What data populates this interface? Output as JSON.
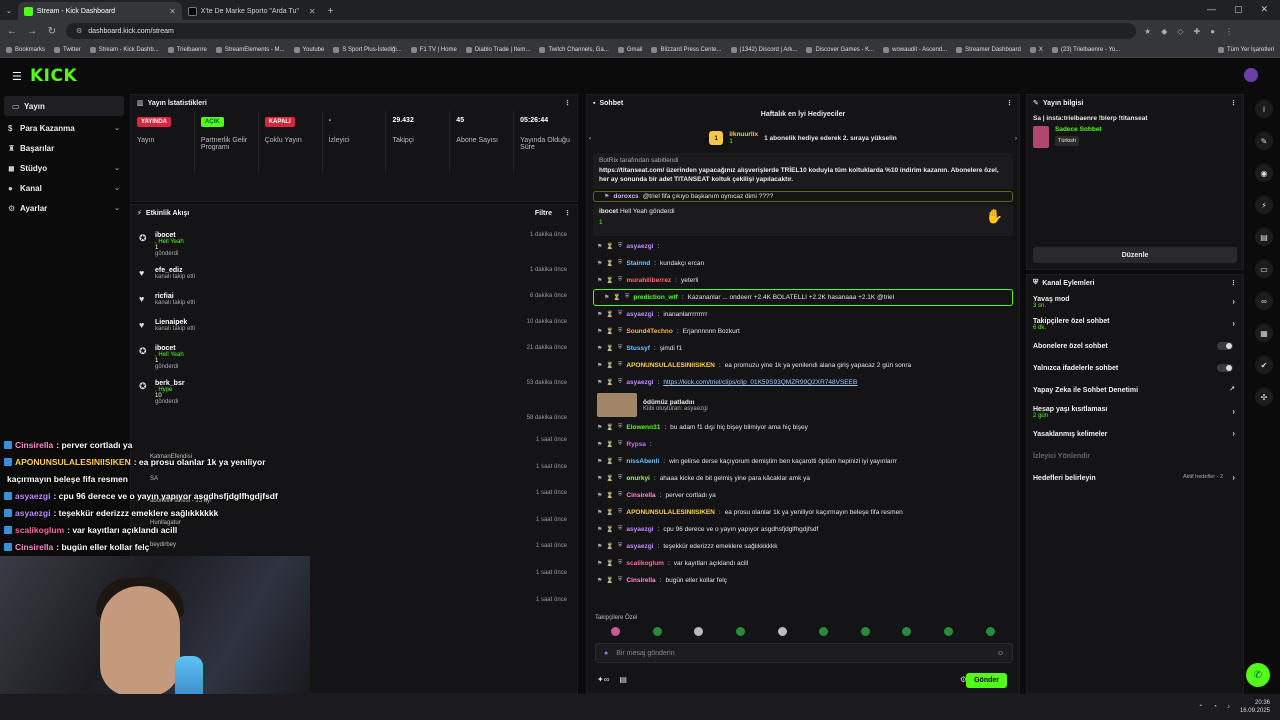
{
  "browser": {
    "tabs": [
      {
        "title": "Stream - Kick Dashboard",
        "active": true
      },
      {
        "title": "X'te De Marke Sporto \"Arda Tu\"",
        "active": false
      }
    ],
    "url": "dashboard.kick.com/stream",
    "bookmarks": [
      "Bookmarks",
      "Twitter",
      "Stream - Kick Dashb...",
      "Trielbaenre",
      "StreamElements - M...",
      "Youtube",
      "S Sport Plus-İstediği...",
      "F1 TV | Home",
      "Diablo Trade | Item...",
      "Twitch Channels, Ga...",
      "Gmail",
      "Blizzard Press Cente...",
      "(1342) Discord | Ark...",
      "Discover Games - K...",
      "wowaudit - Ascend...",
      "Streamer Dashboard",
      "X",
      "(23) Trielbaenre - Yo...",
      "Tüm Yer İşaretleri"
    ]
  },
  "logo": "KICK",
  "sidebar": {
    "items": [
      {
        "label": "Yayın",
        "icon": "video-icon",
        "active": true
      },
      {
        "label": "Para Kazanma",
        "icon": "dollar-icon",
        "active": false
      },
      {
        "label": "Başarılar",
        "icon": "trophy-icon",
        "active": false
      },
      {
        "label": "Stüdyo",
        "icon": "studio-icon",
        "active": false
      },
      {
        "label": "Kanal",
        "icon": "user-icon",
        "active": false
      },
      {
        "label": "Ayarlar",
        "icon": "gear-icon",
        "active": false
      }
    ]
  },
  "stats": {
    "title": "Yayın İstatistikleri",
    "items": [
      {
        "badge": "YAYINDA",
        "label": "Yayın",
        "color": "red"
      },
      {
        "badge": "AÇIK",
        "label": "Partnerlik Gelir Programı",
        "color": "green"
      },
      {
        "badge": "KAPALI",
        "label": "Çoklu Yayın",
        "color": "red"
      },
      {
        "value": "-",
        "label": "İzleyici"
      },
      {
        "value": "29.432",
        "label": "Takipçi"
      },
      {
        "value": "45",
        "label": "Abone Sayısı"
      },
      {
        "value": "05:26:44",
        "label": "Yayında Olduğu Süre"
      }
    ]
  },
  "activity": {
    "title": "Etkinlik Akışı",
    "filter": "Filtre",
    "items": [
      {
        "name": "ibocet",
        "sub": ", Hell Yeah",
        "count": "1",
        "action": "gönderdi",
        "time": "1 dakika önce",
        "icon": "gift-icon"
      },
      {
        "name": "efe_ediz",
        "action": "kanalı takip etti",
        "time": "1 dakika önce",
        "icon": "heart-icon"
      },
      {
        "name": "ricfiai",
        "action": "kanalı takip etti",
        "time": "6 dakika önce",
        "icon": "heart-icon"
      },
      {
        "name": "Lienaipek",
        "action": "kanalı takip etti",
        "time": "10 dakika önce",
        "icon": "heart-icon"
      },
      {
        "name": "ibocet",
        "sub": ", Hell Yeah",
        "count": "1",
        "action": "gönderdi",
        "time": "21 dakika önce",
        "icon": "gift-icon"
      },
      {
        "name": "berk_bsr",
        "sub": ", Hype",
        "count": "10",
        "action": "gönderdi",
        "time": "53 dakika önce",
        "icon": "gift-icon"
      }
    ],
    "extra_times": [
      "58 dakika önce",
      "1 saat önce",
      "1 saat önce",
      "1 saat önce",
      "1 saat önce",
      "1 saat önce",
      "1 saat önce",
      "1 saat önce"
    ]
  },
  "chat": {
    "title": "Sohbet",
    "weekly_title": "Haftalık en İyi Hediyeciler",
    "top_gifter": "ilknuurlix",
    "top_gifter_count": "1",
    "top_gifter_note": "1 abonelik hediye ederek 2. sıraya yükselin",
    "pinned_by": "BotRix tarafından sabitlendi",
    "pinned_text": "https://titanseat.com/ üzerinden yapacağınız alışverişlerde TRİEL10 koduyla tüm koltuklarda %10 indirim kazanın. Abonelere özel, her ay sonunda bir adet TITANSEAT koltuk çekilişi yapılacaktır.",
    "gift_user": "ibocet",
    "gift_text": "Hell Yeah gönderdi",
    "gift_count": "1",
    "messages": [
      {
        "user": "doroxcs",
        "text": "@triel fifa çıkıyo başkanım oynıcaz dimi ????",
        "color": "#d6b7ff"
      },
      {
        "user": "asyaezgi",
        "text": "",
        "color": "#c08cff"
      },
      {
        "user": "Stainnd",
        "text": "kundakçı ercan",
        "color": "#6fc3ff"
      },
      {
        "user": "murahiliberrez",
        "text": "yeterli",
        "color": "#ff6b6b"
      },
      {
        "user": "prediction_wtf",
        "text": "Kazananlar ... ondeerr +2.4K BOLATELLI +2.2K hasanaaa +2.1K @triel",
        "color": "#53fc18",
        "highlight": true
      },
      {
        "user": "asyaezgi",
        "text": "inananlarrrrrrrrr",
        "color": "#c08cff"
      },
      {
        "user": "Sound4Techno",
        "text": "Erjannnnnn Bozkurt",
        "color": "#ffb347"
      },
      {
        "user": "Stussyf",
        "text": "şimdi f1",
        "color": "#6fc3ff"
      },
      {
        "user": "APONUNSULALESINIISIKEN",
        "text": "ea promuzu yine 1k ya yenilendi alana giriş yapacaz 2 gün sonra",
        "color": "#ffd24d"
      },
      {
        "user": "asyaezgi",
        "text": "https://kick.com/triel/clips/clip_01K59S93QMZR99Q2XR748VSEEB",
        "color": "#c08cff"
      },
      {
        "user": "Elowenn31",
        "text": "bu adam f1 dışı hiç bişey bilmiyor ama hiç bişey",
        "color": "#53fc18"
      },
      {
        "user": "Rypsa",
        "text": "",
        "color": "#d06bff"
      },
      {
        "user": "nissAbenli",
        "text": "win gelirse derse kaçıyorum demiştim ben kaçarotti öptüm hepinizi iyi yayınlarrr",
        "color": "#6fc3ff"
      },
      {
        "user": "onurkyi",
        "text": "ahaaa kicke de bit gelmiş yine para kâcaklar amk ya",
        "color": "#b0e57c"
      },
      {
        "user": "Cinsirella",
        "text": "perver cortladı ya",
        "color": "#ff8fd0"
      },
      {
        "user": "APONUNSULALESINIISIKEN",
        "text": "ea prosu olanlar 1k ya yeniliyor kaçırmayın beleşe fifa resmen",
        "color": "#ffd24d"
      },
      {
        "user": "asyaezgi",
        "text": "cpu 96 derece ve o yayın yapıyor asgdhsfjdglfhgdjfsdf",
        "color": "#c08cff"
      },
      {
        "user": "asyaezgi",
        "text": "teşekkür ederizzz emeklere sağlıkkkkkk",
        "color": "#c08cff"
      },
      {
        "user": "scalikoglum",
        "text": "var kayıtları açıklandı acill",
        "color": "#ff6b9a"
      },
      {
        "user": "Cinsirella",
        "text": "bugün eller kollar felç",
        "color": "#ff8fd0"
      }
    ],
    "clip_title": "ödümüz patladııı",
    "clip_by": "Klibi oluşturan: asyaezgi",
    "followers_only": "Takipçilere Özel",
    "placeholder": "Bir mesaj gönderin",
    "send_label": "Gönder"
  },
  "info": {
    "title": "Yayın bilgisi",
    "stream_title": "Sa | insta:trielbaenre !blerp !titanseat",
    "category": "Sadece Sohbet",
    "language": "Türkish",
    "edit_label": "Düzenle"
  },
  "channel_actions": {
    "title": "Kanal Eylemleri",
    "items": [
      {
        "label": "Yavaş mod",
        "sub": "3 sn.",
        "type": "arrow"
      },
      {
        "label": "Takipçilere özel sohbet",
        "sub": "6 dk.",
        "type": "arrow"
      },
      {
        "label": "Abonelere özel sohbet",
        "type": "toggle"
      },
      {
        "label": "Yalnızca ifadelerle sohbet",
        "type": "toggle"
      },
      {
        "label": "Yapay Zeka ile Sohbet Denetimi",
        "type": "link"
      },
      {
        "label": "Hesap yaşı kısıtlaması",
        "sub": "2 gün",
        "type": "arrow"
      },
      {
        "label": "Yasaklanmış kelimeler",
        "type": "arrow"
      },
      {
        "label": "İzleyici Yönlendir",
        "type": "disabled"
      },
      {
        "label": "Hedefleri belirleyin",
        "extra": "Aktif hedefler - 2",
        "type": "arrow"
      }
    ]
  },
  "overlay": {
    "lines": [
      {
        "user": "Cinsirella",
        "text": ": perver cortladı ya",
        "color": "#ff8fd0"
      },
      {
        "user": "APONUNSULALESINIISIKEN",
        "text": ": ea prosu olanlar 1k ya yeniliyor",
        "color": "#ffd24d"
      },
      {
        "user": "",
        "text": "kaçırmayın beleşe fifa resmen",
        "color": "#ffffff"
      },
      {
        "user": "asyaezgi",
        "text": ": cpu 96 derece ve o yayın yapıyor asgdhsfjdglfhgdjfsdf",
        "color": "#c08cff"
      },
      {
        "user": "asyaezgi",
        "text": ": teşekkür ederizzz emeklere sağlıkkkkkk",
        "color": "#c08cff"
      },
      {
        "user": "scalikoglum",
        "text": ": var kayıtları açıklandı acill",
        "color": "#ff6b9a"
      },
      {
        "user": "Cinsirella",
        "text": ": bugün eller kollar felç",
        "color": "#ff8fd0"
      }
    ],
    "ghost_names": [
      "KatmanEfendisi",
      "SA",
      "abonelik süresi - 13 ay!",
      "Hunllagatur",
      "beydirbey"
    ]
  },
  "taskbar": {
    "time": "20:36",
    "date": "16.09.2025"
  },
  "colors": {
    "accent": "#53fc18",
    "live_red": "#d9263d",
    "panel": "#141416",
    "bg": "#0b0b0c"
  }
}
